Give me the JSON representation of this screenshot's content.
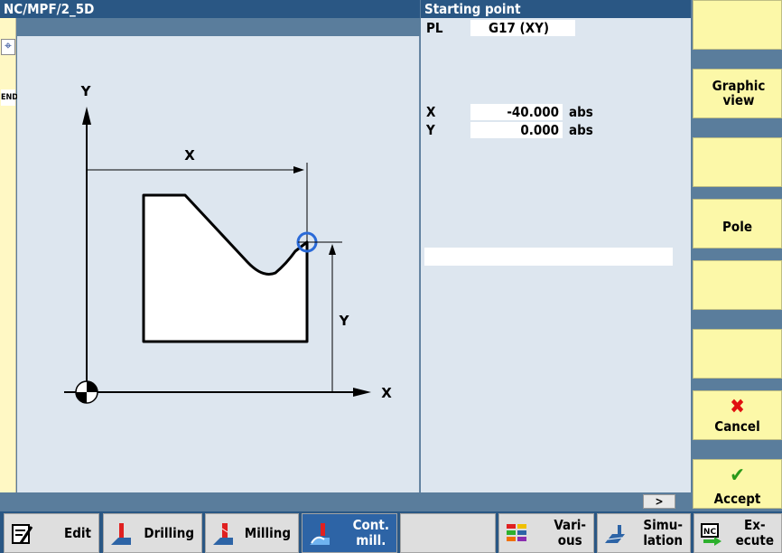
{
  "header": {
    "program_path": "NC/MPF/2_5D",
    "screen_title": "Starting point"
  },
  "left_strip": {
    "end_marker": "END"
  },
  "graphic": {
    "axis_y": "Y",
    "axis_x": "X",
    "dim_x": "X",
    "dim_y": "Y"
  },
  "params": {
    "pl_label": "PL",
    "pl_value": "G17 (XY)",
    "x_label": "X",
    "x_value": "-40.000",
    "x_unit": "abs",
    "y_label": "Y",
    "y_value": "0.000",
    "y_unit": "abs"
  },
  "status": {
    "more_label": ">"
  },
  "vertical_softkeys": [
    {
      "label": ""
    },
    {
      "label": "Graphic view"
    },
    {
      "label": ""
    },
    {
      "label": "Pole"
    },
    {
      "label": ""
    },
    {
      "label": ""
    },
    {
      "label": "Cancel",
      "icon": "cancel-icon",
      "color": "#e01010"
    },
    {
      "label": "Accept",
      "icon": "accept-icon",
      "color": "#2a9a1a"
    }
  ],
  "horizontal_softkeys": {
    "edit": "Edit",
    "drilling": "Drilling",
    "milling": "Milling",
    "cont_mill_1": "Cont.",
    "cont_mill_2": "mill.",
    "various_1": "Vari-",
    "various_2": "ous",
    "simulation_1": "Simu-",
    "simulation_2": "lation",
    "execute_1": "Ex-",
    "execute_2": "ecute"
  },
  "colors": {
    "header_blue": "#2a5784",
    "panel_bg": "#dde6ef",
    "softkey_yellow": "#fcf8a8",
    "active_blue": "#2d64a6",
    "marker_blue": "#2a6ad8"
  }
}
